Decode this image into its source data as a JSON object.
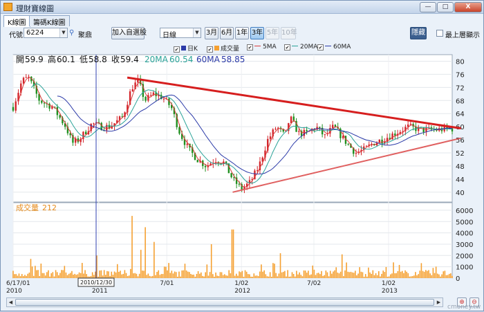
{
  "window": {
    "title": "理財寶線圖",
    "minimize": "—",
    "maximize": "□",
    "close": "X"
  },
  "tabs": [
    {
      "label": "K線圖"
    },
    {
      "label": "籌碼K線圖"
    }
  ],
  "toolbar": {
    "code_label": "代號",
    "code_value": "6224",
    "stock_name": "聚鼎",
    "add_watchlist": "加入自選股",
    "period_select": "日線",
    "ranges": [
      "3月",
      "6月",
      "1年",
      "3年",
      "5年",
      "10年"
    ],
    "selected_range": "3年",
    "disabled_ranges": [
      "5年",
      "10年"
    ],
    "hidden_button": "隱藏",
    "always_on_top": "最上層顯示"
  },
  "legend": {
    "items": [
      "日K",
      "成交量",
      "5MA",
      "20MA",
      "60MA"
    ]
  },
  "ohlc_label": {
    "open_label": "開",
    "open": "59.9",
    "high_label": "高",
    "high": "60.1",
    "low_label": "低",
    "low": "58.8",
    "close_label": "收",
    "close": "59.4",
    "ma20_label": "20MA",
    "ma20": "60.54",
    "ma60_label": "60MA",
    "ma60": "58.85"
  },
  "volume_label": {
    "label": "成交量",
    "value": "212"
  },
  "cursor_date": "2010/12/30",
  "watermark": "cmoney.tw",
  "colors": {
    "up": "#d4252b",
    "down": "#1f8f1f",
    "ma5": "#d93b3b",
    "ma20": "#2aa398",
    "ma60": "#2b3aa8",
    "volume": "#f5a030",
    "trend_upper": "#d61e1e",
    "trend_lower": "#e06060",
    "crosshair": "#3040b0"
  },
  "chart_data": [
    {
      "type": "candlestick",
      "title": "",
      "y_ticks": [
        40,
        44,
        48,
        52,
        56,
        60,
        64,
        68,
        72,
        76,
        80
      ],
      "ylim": [
        37,
        82
      ],
      "x_ticks": [
        {
          "label": "6/17/01",
          "sub": "2010",
          "t": 0.0
        },
        {
          "label": "",
          "sub": "2011",
          "t": 0.195
        },
        {
          "label": "7/01",
          "sub": "",
          "t": 0.35
        },
        {
          "label": "1/02",
          "sub": "2012",
          "t": 0.52
        },
        {
          "label": "7/02",
          "sub": "",
          "t": 0.685
        },
        {
          "label": "1/02",
          "sub": "2013",
          "t": 0.855
        }
      ],
      "price_keypoints": [
        [
          0.0,
          66
        ],
        [
          0.02,
          74
        ],
        [
          0.035,
          75
        ],
        [
          0.06,
          68
        ],
        [
          0.09,
          66
        ],
        [
          0.12,
          60
        ],
        [
          0.135,
          55
        ],
        [
          0.15,
          56
        ],
        [
          0.18,
          61
        ],
        [
          0.2,
          60
        ],
        [
          0.22,
          60
        ],
        [
          0.25,
          63
        ],
        [
          0.27,
          72
        ],
        [
          0.285,
          74
        ],
        [
          0.3,
          68
        ],
        [
          0.32,
          70
        ],
        [
          0.34,
          69
        ],
        [
          0.36,
          66
        ],
        [
          0.38,
          58
        ],
        [
          0.4,
          53
        ],
        [
          0.42,
          50
        ],
        [
          0.44,
          48
        ],
        [
          0.46,
          50
        ],
        [
          0.48,
          49
        ],
        [
          0.5,
          44
        ],
        [
          0.52,
          41
        ],
        [
          0.54,
          43
        ],
        [
          0.56,
          48
        ],
        [
          0.58,
          56
        ],
        [
          0.6,
          60
        ],
        [
          0.62,
          57
        ],
        [
          0.63,
          63
        ],
        [
          0.65,
          58
        ],
        [
          0.67,
          58
        ],
        [
          0.69,
          60
        ],
        [
          0.71,
          57
        ],
        [
          0.73,
          60
        ],
        [
          0.76,
          55
        ],
        [
          0.78,
          52
        ],
        [
          0.8,
          53
        ],
        [
          0.82,
          55
        ],
        [
          0.84,
          56
        ],
        [
          0.87,
          58
        ],
        [
          0.9,
          60
        ],
        [
          0.93,
          59
        ],
        [
          0.96,
          59
        ],
        [
          1.0,
          59.4
        ]
      ],
      "trendlines": [
        {
          "name": "upper",
          "from": [
            0.26,
            75
          ],
          "to": [
            1.02,
            59.5
          ]
        },
        {
          "name": "lower",
          "from": [
            0.5,
            40
          ],
          "to": [
            1.02,
            56.5
          ]
        }
      ]
    },
    {
      "type": "bar",
      "title": "",
      "y_ticks": [
        0,
        1000,
        2000,
        3000,
        4000,
        5000,
        6000
      ],
      "ylim": [
        0,
        6300
      ],
      "spikes": [
        [
          0.27,
          5500
        ],
        [
          0.3,
          4500
        ],
        [
          0.5,
          4300
        ],
        [
          0.32,
          3200
        ],
        [
          0.45,
          3000
        ],
        [
          0.29,
          2500
        ],
        [
          0.61,
          2200
        ],
        [
          0.75,
          2100
        ],
        [
          0.19,
          2000
        ],
        [
          0.04,
          1700
        ]
      ]
    }
  ]
}
